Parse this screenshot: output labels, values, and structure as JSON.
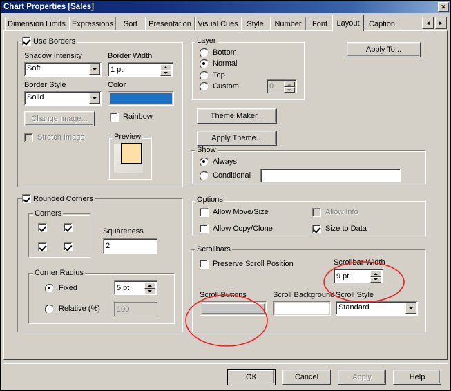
{
  "window": {
    "title": "Chart Properties [Sales]",
    "close_label": "✕",
    "titlebar_color": "#0a246a"
  },
  "tabs": {
    "items": [
      {
        "label": "Dimension Limits",
        "selected": false
      },
      {
        "label": "Expressions",
        "selected": false
      },
      {
        "label": "Sort",
        "selected": false
      },
      {
        "label": "Presentation",
        "selected": false
      },
      {
        "label": "Visual Cues",
        "selected": false
      },
      {
        "label": "Style",
        "selected": false
      },
      {
        "label": "Number",
        "selected": false
      },
      {
        "label": "Font",
        "selected": false
      },
      {
        "label": "Layout",
        "selected": true
      },
      {
        "label": "Caption",
        "selected": false
      }
    ],
    "scroll_left": "◄",
    "scroll_right": "►"
  },
  "use_borders": {
    "group_label": "Use Borders",
    "checked": true,
    "shadow_intensity_label": "Shadow Intensity",
    "shadow_intensity_value": "Soft",
    "border_width_label": "Border Width",
    "border_width_value": "1 pt",
    "border_style_label": "Border Style",
    "border_style_value": "Solid",
    "color_label": "Color",
    "color_value": "#1b72c4",
    "change_image_label": "Change Image...",
    "rainbow_label": "Rainbow",
    "rainbow_checked": false,
    "stretch_image_label": "Stretch Image",
    "stretch_image_checked": false,
    "preview_label": "Preview",
    "preview_fill": "#fce0a8"
  },
  "rounded_corners": {
    "group_label": "Rounded Corners",
    "checked": true,
    "corners_label": "Corners",
    "corner_tl_checked": true,
    "corner_tr_checked": true,
    "corner_bl_checked": true,
    "corner_br_checked": true,
    "squareness_label": "Squareness",
    "squareness_value": "2",
    "corner_radius_label": "Corner Radius",
    "fixed_label": "Fixed",
    "fixed_selected": true,
    "fixed_value": "5 pt",
    "relative_label": "Relative (%)",
    "relative_selected": false,
    "relative_value": "100"
  },
  "layer": {
    "group_label": "Layer",
    "options": [
      {
        "label": "Bottom",
        "selected": false
      },
      {
        "label": "Normal",
        "selected": true
      },
      {
        "label": "Top",
        "selected": false
      },
      {
        "label": "Custom",
        "selected": false
      }
    ],
    "custom_value": "0"
  },
  "theme": {
    "theme_maker_label": "Theme Maker...",
    "apply_theme_label": "Apply Theme..."
  },
  "apply_to": {
    "label": "Apply To..."
  },
  "show": {
    "group_label": "Show",
    "always_label": "Always",
    "always_selected": true,
    "conditional_label": "Conditional",
    "conditional_selected": false,
    "conditional_value": ""
  },
  "options": {
    "group_label": "Options",
    "allow_move_size_label": "Allow Move/Size",
    "allow_move_size_checked": false,
    "allow_info_label": "Allow Info",
    "allow_info_checked": false,
    "allow_copy_clone_label": "Allow Copy/Clone",
    "allow_copy_clone_checked": false,
    "size_to_data_label": "Size to Data",
    "size_to_data_checked": true
  },
  "scrollbars": {
    "group_label": "Scrollbars",
    "preserve_scroll_label": "Preserve Scroll Position",
    "preserve_scroll_checked": false,
    "scrollbar_width_label": "Scrollbar Width",
    "scrollbar_width_value": "9 pt",
    "scroll_buttons_label": "Scroll Buttons",
    "scroll_buttons_color": "#c8c8c8",
    "scroll_background_label": "Scroll Background",
    "scroll_background_color": "#ffffff",
    "scroll_style_label": "Scroll Style",
    "scroll_style_value": "Standard"
  },
  "footer": {
    "ok_label": "OK",
    "cancel_label": "Cancel",
    "apply_label": "Apply",
    "help_label": "Help"
  },
  "annotations": {
    "color": "#ee2222",
    "ellipses": [
      "scrollbar-width-highlight",
      "scroll-buttons-highlight"
    ]
  }
}
